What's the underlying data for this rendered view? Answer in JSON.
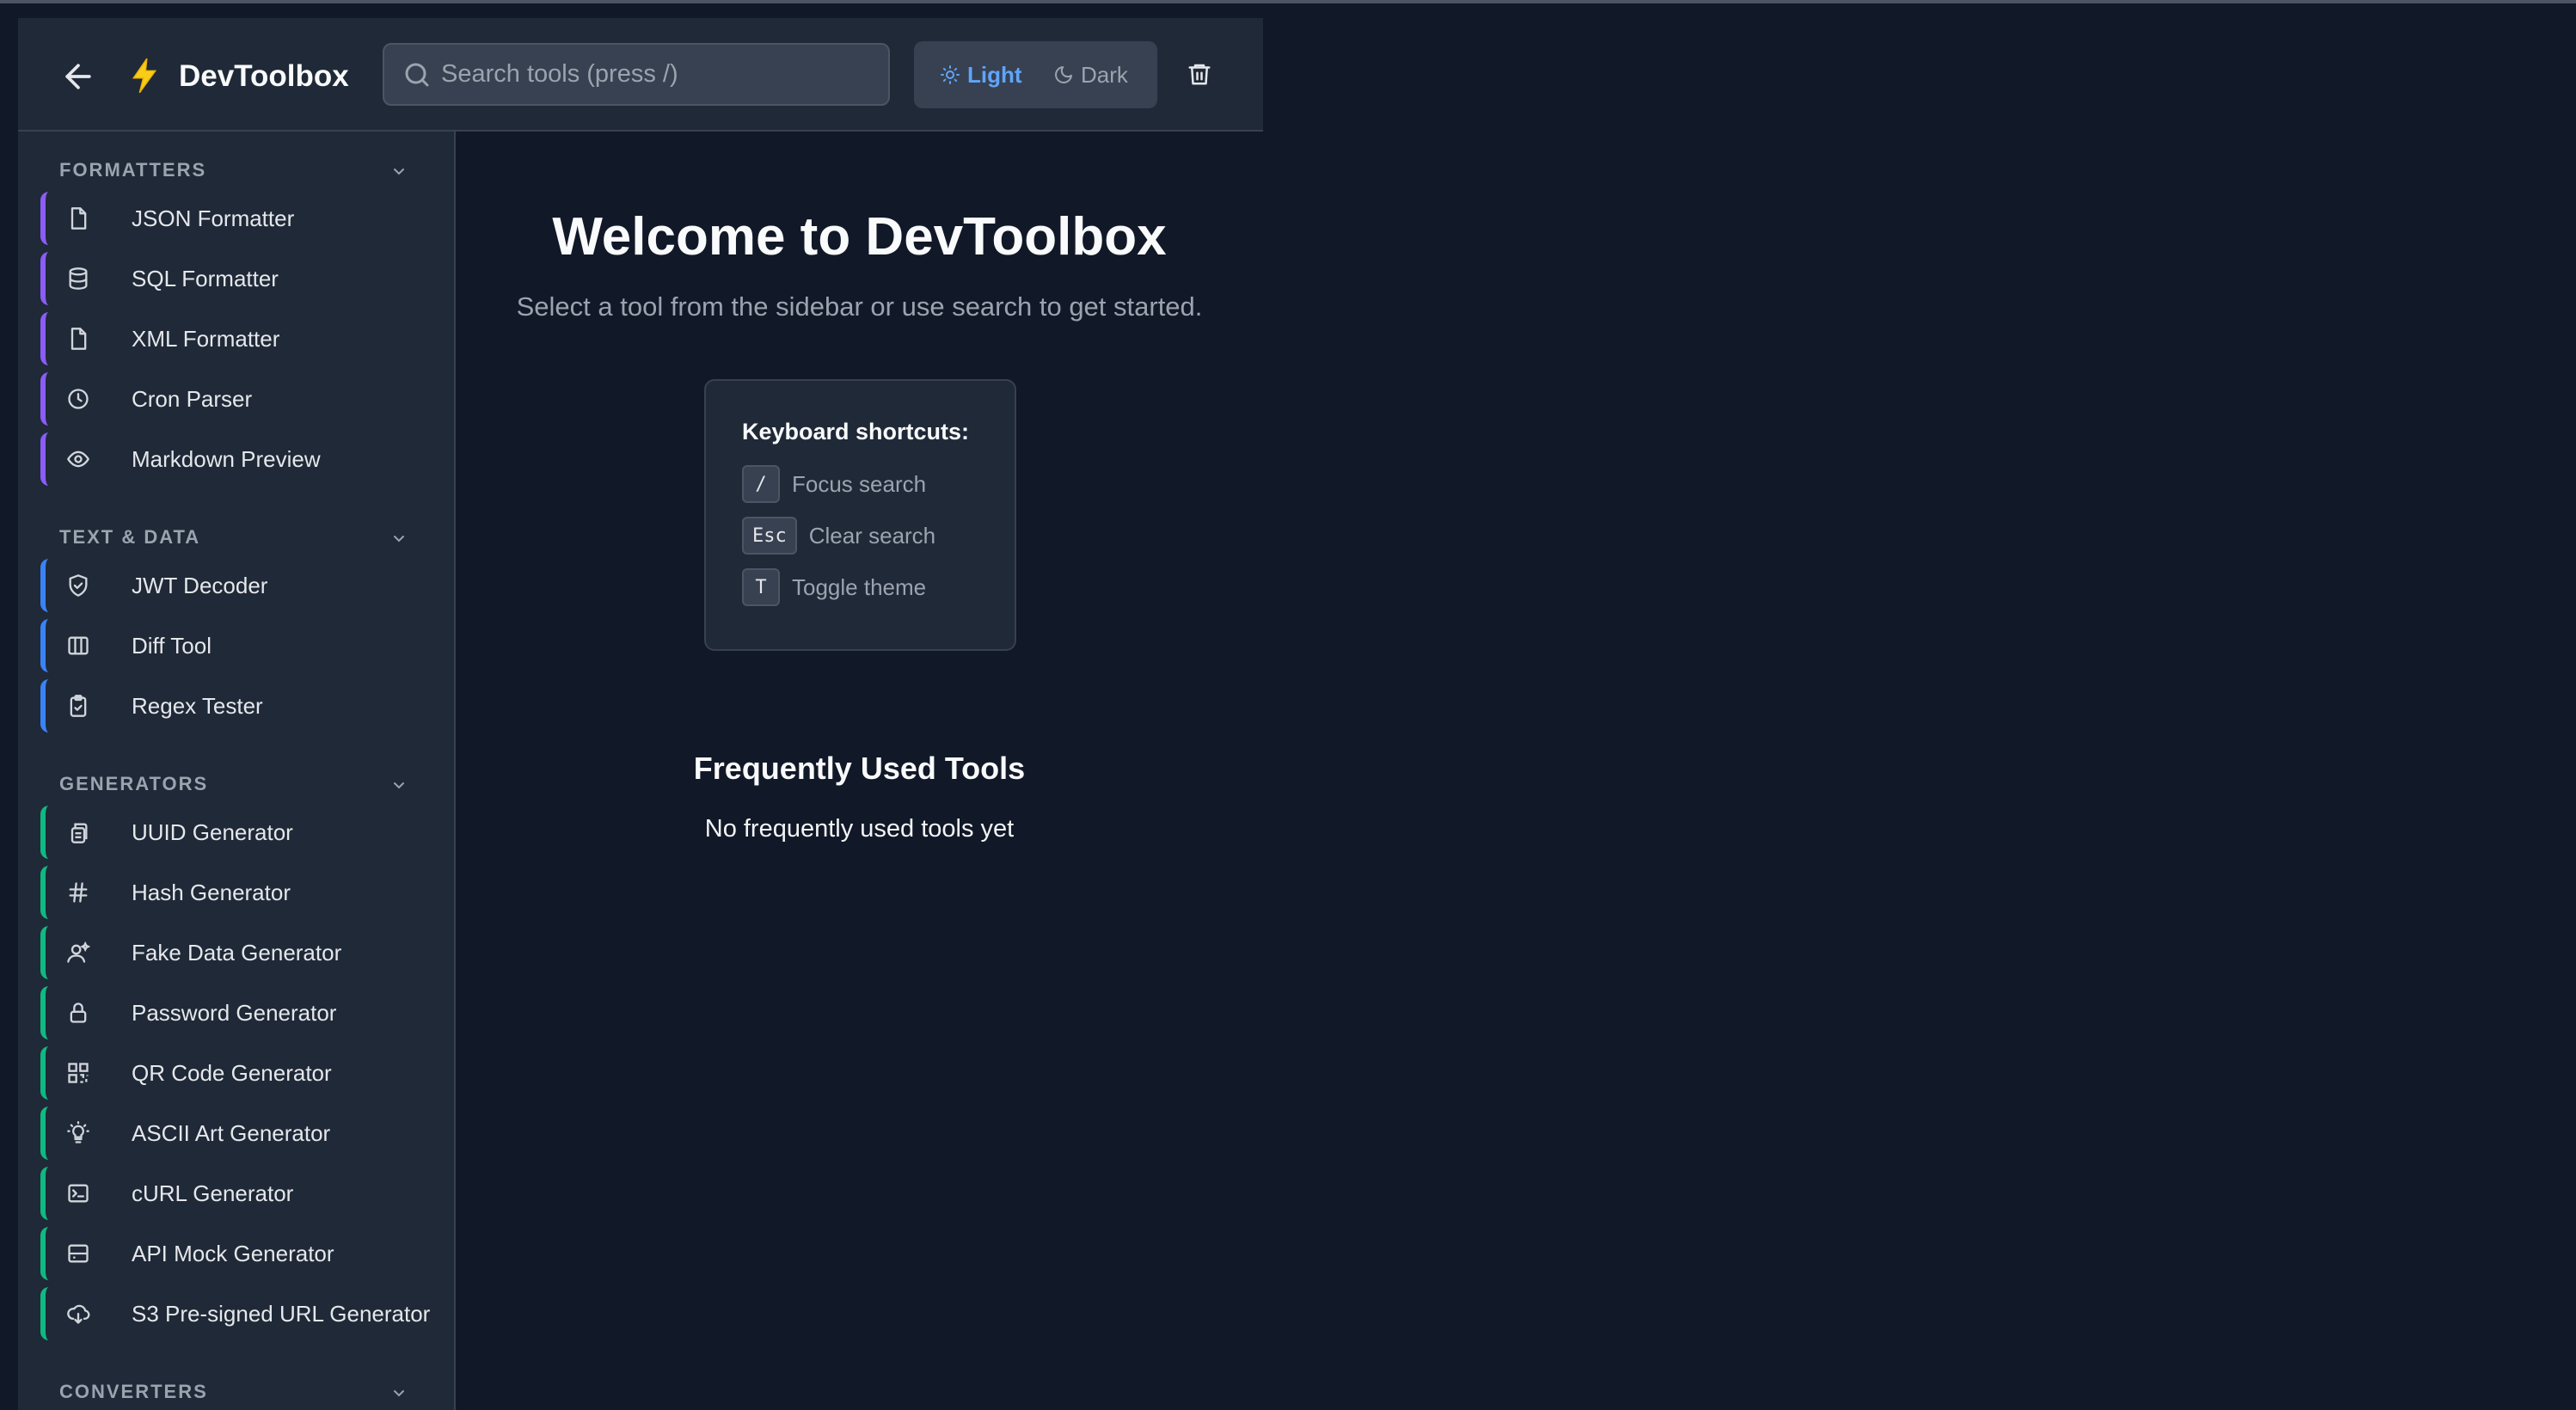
{
  "header": {
    "back_icon": "arrow-left-icon",
    "logo_icon": "lightning-icon",
    "logo_text": "DevToolbox",
    "search_placeholder": "Search tools (press /)",
    "search_value": "",
    "theme_light_label": "Light",
    "theme_dark_label": "Dark",
    "active_theme": "Light",
    "clear_icon": "trash-icon"
  },
  "sidebar": {
    "sections": [
      {
        "title": "FORMATTERS",
        "accent": "#8b5cf6",
        "items": [
          {
            "label": "JSON Formatter",
            "icon": "file-icon"
          },
          {
            "label": "SQL Formatter",
            "icon": "database-icon"
          },
          {
            "label": "XML Formatter",
            "icon": "file-icon"
          },
          {
            "label": "Cron Parser",
            "icon": "clock-icon"
          },
          {
            "label": "Markdown Preview",
            "icon": "eye-icon"
          }
        ]
      },
      {
        "title": "TEXT & DATA",
        "accent": "#3b82f6",
        "items": [
          {
            "label": "JWT Decoder",
            "icon": "shield-check-icon"
          },
          {
            "label": "Diff Tool",
            "icon": "columns-icon"
          },
          {
            "label": "Regex Tester",
            "icon": "clipboard-check-icon"
          }
        ]
      },
      {
        "title": "GENERATORS",
        "accent": "#10b981",
        "items": [
          {
            "label": "UUID Generator",
            "icon": "copy-icon"
          },
          {
            "label": "Hash Generator",
            "icon": "hash-icon"
          },
          {
            "label": "Fake Data Generator",
            "icon": "user-sparkle-icon"
          },
          {
            "label": "Password Generator",
            "icon": "lock-icon"
          },
          {
            "label": "QR Code Generator",
            "icon": "qr-code-icon"
          },
          {
            "label": "ASCII Art Generator",
            "icon": "lightbulb-icon"
          },
          {
            "label": "cURL Generator",
            "icon": "terminal-icon"
          },
          {
            "label": "API Mock Generator",
            "icon": "server-icon"
          },
          {
            "label": "S3 Pre-signed URL Generator",
            "icon": "cloud-download-icon"
          }
        ]
      },
      {
        "title": "CONVERTERS",
        "accent": "#f59e0b",
        "items": []
      }
    ]
  },
  "main": {
    "title": "Welcome to DevToolbox",
    "subtitle": "Select a tool from the sidebar or use search to get started.",
    "shortcuts": {
      "title": "Keyboard shortcuts:",
      "items": [
        {
          "key": "/",
          "label": "Focus search"
        },
        {
          "key": "Esc",
          "label": "Clear search"
        },
        {
          "key": "T",
          "label": "Toggle theme"
        }
      ]
    },
    "frequent": {
      "title": "Frequently Used Tools",
      "empty_text": "No frequently used tools yet"
    }
  }
}
